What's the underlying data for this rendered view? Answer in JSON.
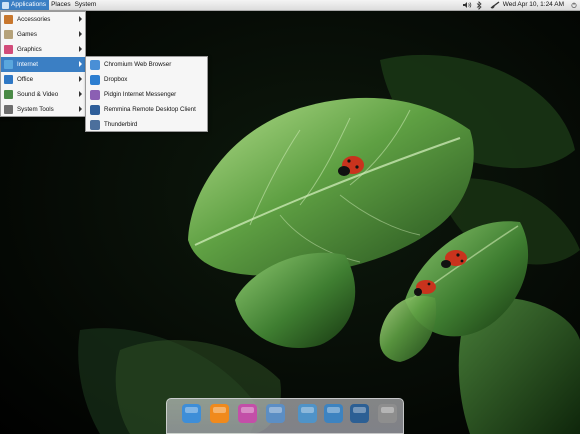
{
  "panel": {
    "menus": [
      "Applications",
      "Places",
      "System"
    ],
    "clock": "Wed Apr 10,  1:24 AM"
  },
  "apps_menu": {
    "items": [
      {
        "label": "Accessories",
        "color": "#c8772d"
      },
      {
        "label": "Games",
        "color": "#b5a27a"
      },
      {
        "label": "Graphics",
        "color": "#d24c7a"
      },
      {
        "label": "Internet",
        "color": "#5aa7dd"
      },
      {
        "label": "Office",
        "color": "#2f78c5"
      },
      {
        "label": "Sound & Video",
        "color": "#4a8a46"
      },
      {
        "label": "System Tools",
        "color": "#6e6e6e"
      }
    ],
    "active_index": 3
  },
  "internet_menu": {
    "items": [
      {
        "label": "Chromium Web Browser",
        "color": "#4a8fd6"
      },
      {
        "label": "Dropbox",
        "color": "#2d7ed0"
      },
      {
        "label": "Pidgin Internet Messenger",
        "color": "#8b5fb3"
      },
      {
        "label": "Remmina Remote Desktop Client",
        "color": "#2f5f9a"
      },
      {
        "label": "Thunderbird",
        "color": "#4c6f9c"
      }
    ]
  },
  "dock": {
    "items": [
      {
        "name": "chromium",
        "color": "#3e8ed8"
      },
      {
        "name": "vlc",
        "color": "#f08a1c"
      },
      {
        "name": "audio-player",
        "color": "#c34fa8"
      },
      {
        "name": "document-viewer",
        "color": "#5c8ec4"
      },
      {
        "name": "home-folder",
        "color": "#4f93c8"
      },
      {
        "name": "files-folder",
        "color": "#3d83c0"
      },
      {
        "name": "screenshot-tool",
        "color": "#2c5f94"
      },
      {
        "name": "trash",
        "color": "#8e8e8e"
      }
    ]
  }
}
